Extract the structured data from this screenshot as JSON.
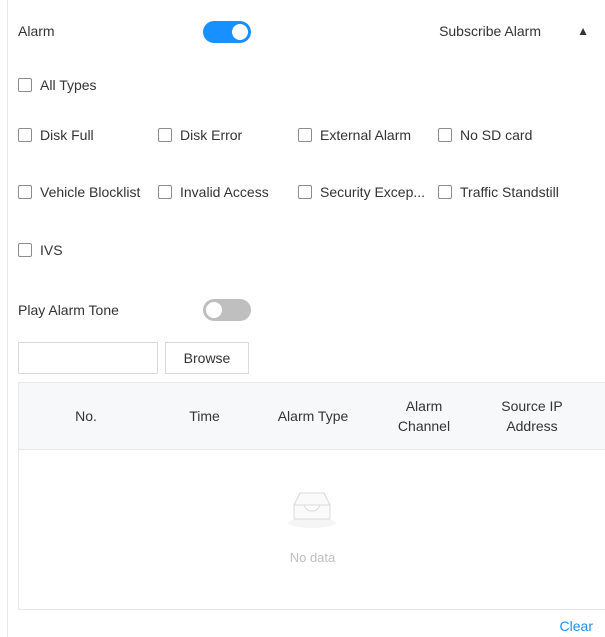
{
  "header": {
    "alarm_label": "Alarm",
    "alarm_enabled": true,
    "subscribe_label": "Subscribe Alarm",
    "collapse_glyph": "▲"
  },
  "types": {
    "all": "All Types",
    "row1": [
      "Disk Full",
      "Disk Error",
      "External Alarm",
      "No SD card"
    ],
    "row2": [
      "Vehicle Blocklist",
      "Invalid Access",
      "Security Excep...",
      "Traffic Standstill"
    ],
    "row3": [
      "IVS"
    ]
  },
  "tone": {
    "label": "Play Alarm Tone",
    "enabled": false,
    "file_value": "",
    "browse_label": "Browse"
  },
  "table": {
    "columns": [
      "No.",
      "Time",
      "Alarm Type",
      "Alarm Channel",
      "Source IP Address"
    ],
    "rows": [],
    "empty_text": "No data"
  },
  "footer": {
    "clear_label": "Clear"
  },
  "colors": {
    "accent": "#1890ff",
    "toggle_off": "#bfbfbf",
    "header_bg": "#f7f8fa"
  }
}
